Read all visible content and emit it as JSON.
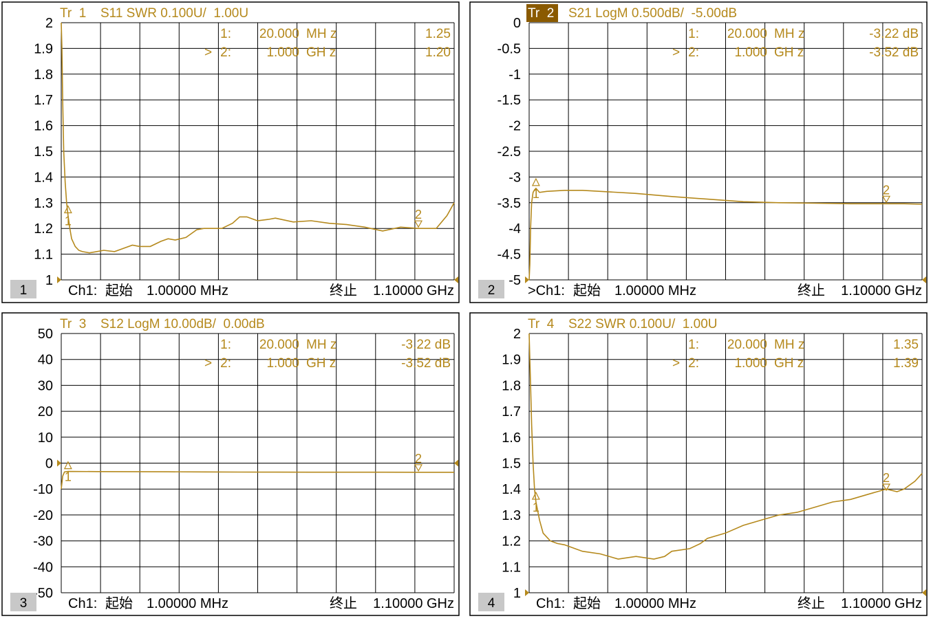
{
  "colors": {
    "trace": "#b5891c",
    "marker_text": "#b5891c",
    "active_title_bg": "#8a5a00",
    "grid": "#000000",
    "panel_border": "#000000",
    "label_text": "#000000",
    "channel_box": "#c8c8c8"
  },
  "chart_data": [
    {
      "type": "line",
      "panel_number": "1",
      "trace_label": "Tr  1",
      "measurement": "S11 SWR 0.100U/  1.00U",
      "active": false,
      "y_ticks": [
        "2",
        "1.9",
        "1.8",
        "1.7",
        "1.6",
        "1.5",
        "1.4",
        "1.3",
        "1.2",
        "1.1",
        "1"
      ],
      "y_tick_values": [
        2,
        1.9,
        1.8,
        1.7,
        1.6,
        1.5,
        1.4,
        1.3,
        1.2,
        1.1,
        1
      ],
      "ylim": [
        1,
        2
      ],
      "xlim_mhz": [
        1,
        1100
      ],
      "grid": true,
      "markers": [
        {
          "num": "1:",
          "freq": "20.000",
          "unit": "MH z",
          "value": "1.25",
          "prefix": "",
          "label": "1",
          "x_mhz": 20,
          "y": 1.25
        },
        {
          "num": "2:",
          "freq": "1.000",
          "unit": "GH z",
          "value": "1.20",
          "prefix": "> ",
          "label": "2",
          "x_mhz": 1000,
          "y": 1.2
        }
      ],
      "series": [
        {
          "x_mhz": [
            1,
            3,
            5,
            8,
            12,
            16,
            20,
            25,
            30,
            40,
            50,
            60,
            80,
            100,
            120,
            150,
            170,
            200,
            220,
            250,
            280,
            300,
            320,
            350,
            380,
            400,
            420,
            450,
            480,
            500,
            520,
            550,
            580,
            600,
            650,
            700,
            750,
            800,
            850,
            900,
            950,
            1000,
            1020,
            1050,
            1080,
            1100
          ],
          "y": [
            2.0,
            1.9,
            1.7,
            1.5,
            1.38,
            1.3,
            1.25,
            1.2,
            1.16,
            1.13,
            1.115,
            1.11,
            1.105,
            1.11,
            1.115,
            1.11,
            1.12,
            1.135,
            1.13,
            1.13,
            1.15,
            1.16,
            1.155,
            1.165,
            1.195,
            1.2,
            1.2,
            1.2,
            1.22,
            1.245,
            1.245,
            1.23,
            1.235,
            1.24,
            1.225,
            1.23,
            1.22,
            1.215,
            1.205,
            1.19,
            1.205,
            1.2,
            1.2,
            1.2,
            1.25,
            1.3
          ]
        }
      ],
      "channel_label": "Ch1:",
      "start_label": "起始",
      "start_value": "1.00000 MHz",
      "stop_label": "终止",
      "stop_value": "1.10000 GHz"
    },
    {
      "type": "line",
      "panel_number": "2",
      "trace_label": "Tr  2",
      "measurement": "S21 LogM 0.500dB/  -5.00dB",
      "active": true,
      "y_ticks": [
        "0",
        "-0.5",
        "-1",
        "-1.5",
        "-2",
        "-2.5",
        "-3",
        "-3.5",
        "-4",
        "-4.5",
        "-5"
      ],
      "y_tick_values": [
        0,
        -0.5,
        -1,
        -1.5,
        -2,
        -2.5,
        -3,
        -3.5,
        -4,
        -4.5,
        -5
      ],
      "ylim": [
        -5,
        0
      ],
      "xlim_mhz": [
        1,
        1100
      ],
      "grid": true,
      "markers": [
        {
          "num": "1:",
          "freq": "20.000",
          "unit": "MH z",
          "value": "-3.22 dB",
          "prefix": "",
          "label": "1",
          "x_mhz": 20,
          "y": -3.22
        },
        {
          "num": "2:",
          "freq": "1.000",
          "unit": "GH z",
          "value": "-3.52 dB",
          "prefix": "> ",
          "label": "2",
          "x_mhz": 1000,
          "y": -3.52
        }
      ],
      "series": [
        {
          "x_mhz": [
            1,
            3,
            5,
            8,
            12,
            16,
            20,
            30,
            50,
            100,
            150,
            200,
            300,
            400,
            500,
            600,
            700,
            800,
            900,
            1000,
            1050,
            1100
          ],
          "y": [
            -5.0,
            -4.7,
            -4.0,
            -3.5,
            -3.3,
            -3.25,
            -3.22,
            -3.3,
            -3.28,
            -3.26,
            -3.26,
            -3.28,
            -3.32,
            -3.38,
            -3.43,
            -3.48,
            -3.5,
            -3.51,
            -3.52,
            -3.52,
            -3.52,
            -3.53
          ]
        }
      ],
      "channel_label": ">Ch1:",
      "start_label": "起始",
      "start_value": "1.00000 MHz",
      "stop_label": "终止",
      "stop_value": "1.10000 GHz"
    },
    {
      "type": "line",
      "panel_number": "3",
      "trace_label": "Tr  3",
      "measurement": "S12 LogM 10.00dB/  0.00dB",
      "active": false,
      "y_ticks": [
        "50",
        "40",
        "30",
        "20",
        "10",
        "0",
        "-10",
        "-20",
        "-30",
        "-40",
        "-50"
      ],
      "y_tick_values": [
        50,
        40,
        30,
        20,
        10,
        0,
        -10,
        -20,
        -30,
        -40,
        -50
      ],
      "ylim": [
        -50,
        50
      ],
      "xlim_mhz": [
        1,
        1100
      ],
      "grid": true,
      "markers": [
        {
          "num": "1:",
          "freq": "20.000",
          "unit": "MH z",
          "value": "-3.22 dB",
          "prefix": "",
          "label": "1",
          "x_mhz": 20,
          "y": -3.22
        },
        {
          "num": "2:",
          "freq": "1.000",
          "unit": "GH z",
          "value": "-3.52 dB",
          "prefix": "> ",
          "label": "2",
          "x_mhz": 1000,
          "y": -3.52
        }
      ],
      "series": [
        {
          "x_mhz": [
            1,
            5,
            10,
            20,
            100,
            200,
            300,
            400,
            500,
            600,
            700,
            800,
            900,
            1000,
            1100
          ],
          "y": [
            -10,
            -5,
            -3.4,
            -3.22,
            -3.25,
            -3.3,
            -3.35,
            -3.4,
            -3.45,
            -3.48,
            -3.5,
            -3.5,
            -3.51,
            -3.52,
            -3.52
          ]
        }
      ],
      "channel_label": "Ch1:",
      "start_label": "起始",
      "start_value": "1.00000 MHz",
      "stop_label": "终止",
      "stop_value": "1.10000 GHz"
    },
    {
      "type": "line",
      "panel_number": "4",
      "trace_label": "Tr  4",
      "measurement": "S22 SWR 0.100U/  1.00U",
      "active": false,
      "y_ticks": [
        "2",
        "1.9",
        "1.8",
        "1.7",
        "1.6",
        "1.5",
        "1.4",
        "1.3",
        "1.2",
        "1.1",
        "1"
      ],
      "y_tick_values": [
        2,
        1.9,
        1.8,
        1.7,
        1.6,
        1.5,
        1.4,
        1.3,
        1.2,
        1.1,
        1
      ],
      "ylim": [
        1,
        2
      ],
      "xlim_mhz": [
        1,
        1100
      ],
      "grid": true,
      "markers": [
        {
          "num": "1:",
          "freq": "20.000",
          "unit": "MH z",
          "value": "1.35",
          "prefix": "",
          "label": "1",
          "x_mhz": 20,
          "y": 1.35
        },
        {
          "num": "2:",
          "freq": "1.000",
          "unit": "GH z",
          "value": "1.39",
          "prefix": "> ",
          "label": "2",
          "x_mhz": 1000,
          "y": 1.39
        }
      ],
      "series": [
        {
          "x_mhz": [
            1,
            3,
            5,
            8,
            12,
            16,
            20,
            30,
            40,
            60,
            80,
            100,
            150,
            200,
            250,
            300,
            350,
            380,
            400,
            450,
            480,
            500,
            550,
            600,
            650,
            700,
            750,
            800,
            850,
            900,
            950,
            1000,
            1030,
            1050,
            1080,
            1100
          ],
          "y": [
            2.0,
            1.9,
            1.8,
            1.65,
            1.5,
            1.4,
            1.35,
            1.28,
            1.23,
            1.2,
            1.19,
            1.185,
            1.16,
            1.15,
            1.13,
            1.14,
            1.13,
            1.14,
            1.16,
            1.17,
            1.19,
            1.21,
            1.23,
            1.26,
            1.28,
            1.3,
            1.31,
            1.33,
            1.35,
            1.36,
            1.38,
            1.4,
            1.39,
            1.4,
            1.43,
            1.46
          ]
        }
      ],
      "channel_label": "Ch1:",
      "start_label": "起始",
      "start_value": "1.00000 MHz",
      "stop_label": "终止",
      "stop_value": "1.10000 GHz"
    }
  ]
}
